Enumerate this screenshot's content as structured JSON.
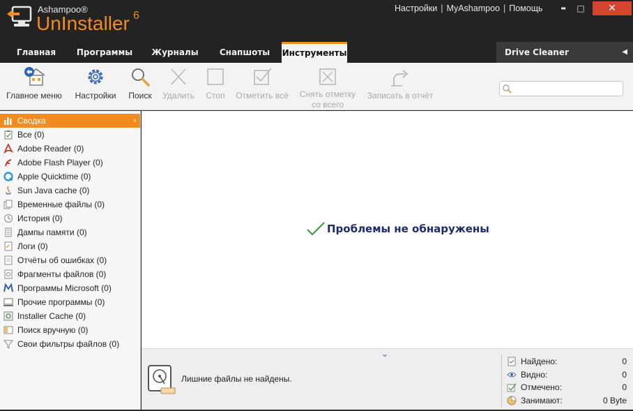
{
  "app": {
    "brand_small": "Ashampoo®",
    "brand_big": "UnInstaller",
    "brand_version": "6"
  },
  "top_links": {
    "settings": "Настройки",
    "account": "MyAshampoo",
    "help": "Помощь",
    "separator": "|"
  },
  "window_controls": {
    "minimize": "▬",
    "maximize": "□",
    "close": "✕"
  },
  "tabs": [
    {
      "label": "Главная"
    },
    {
      "label": "Программы"
    },
    {
      "label": "Журналы"
    },
    {
      "label": "Снапшоты"
    },
    {
      "label": "Инструменты",
      "active": true
    }
  ],
  "drive_cleaner": {
    "label": "Drive Cleaner",
    "arrow": "◀"
  },
  "toolbar": {
    "main_menu": "Главное меню",
    "settings": "Настройки",
    "search": "Поиск",
    "delete": "Удалить",
    "stop": "Стоп",
    "select_all": "Отметить всё",
    "deselect_all_line1": "Снять отметку",
    "deselect_all_line2": "со всего",
    "write_report": "Записать в отчёт",
    "search_placeholder": ""
  },
  "sidebar": {
    "items": [
      {
        "label": "Сводка",
        "icon": "chart-icon",
        "active": true
      },
      {
        "label": "Все (0)",
        "icon": "clipboard-icon"
      },
      {
        "label": "Adobe Reader (0)",
        "icon": "adobe-reader-icon"
      },
      {
        "label": "Adobe Flash Player (0)",
        "icon": "flash-icon"
      },
      {
        "label": "Apple Quicktime (0)",
        "icon": "quicktime-icon"
      },
      {
        "label": "Sun Java cache (0)",
        "icon": "java-icon"
      },
      {
        "label": "Временные файлы (0)",
        "icon": "temp-files-icon"
      },
      {
        "label": "История (0)",
        "icon": "history-icon"
      },
      {
        "label": "Дампы памяти (0)",
        "icon": "memory-dump-icon"
      },
      {
        "label": "Логи (0)",
        "icon": "log-icon"
      },
      {
        "label": "Отчёты об ошибках (0)",
        "icon": "error-report-icon"
      },
      {
        "label": "Фрагменты файлов (0)",
        "icon": "file-fragment-icon"
      },
      {
        "label": "Программы Microsoft (0)",
        "icon": "microsoft-icon"
      },
      {
        "label": "Прочие программы (0)",
        "icon": "programs-icon"
      },
      {
        "label": "Installer Cache (0)",
        "icon": "installer-cache-icon"
      },
      {
        "label": "Поиск вручную (0)",
        "icon": "manual-search-icon"
      },
      {
        "label": "Свои фильтры файлов (0)",
        "icon": "filter-icon"
      }
    ],
    "active_chevron": "›"
  },
  "main": {
    "status": "Проблемы не обнаружены"
  },
  "bottom": {
    "collapse": "⌄",
    "message": "Лишние файлы не найдены.",
    "stats": [
      {
        "label": "Найдено:",
        "value": "0",
        "icon": "found-icon"
      },
      {
        "label": "Видно:",
        "value": "0",
        "icon": "eye-icon"
      },
      {
        "label": "Отмечено:",
        "value": "0",
        "icon": "checked-icon"
      },
      {
        "label": "Занимают:",
        "value": "0 Byte",
        "icon": "pie-icon"
      }
    ]
  },
  "colors": {
    "accent": "#f28c1e",
    "titlebar": "#232323",
    "close": "#d4452e",
    "status_text": "#1d2a6b",
    "check_green": "#3f9a3f"
  }
}
